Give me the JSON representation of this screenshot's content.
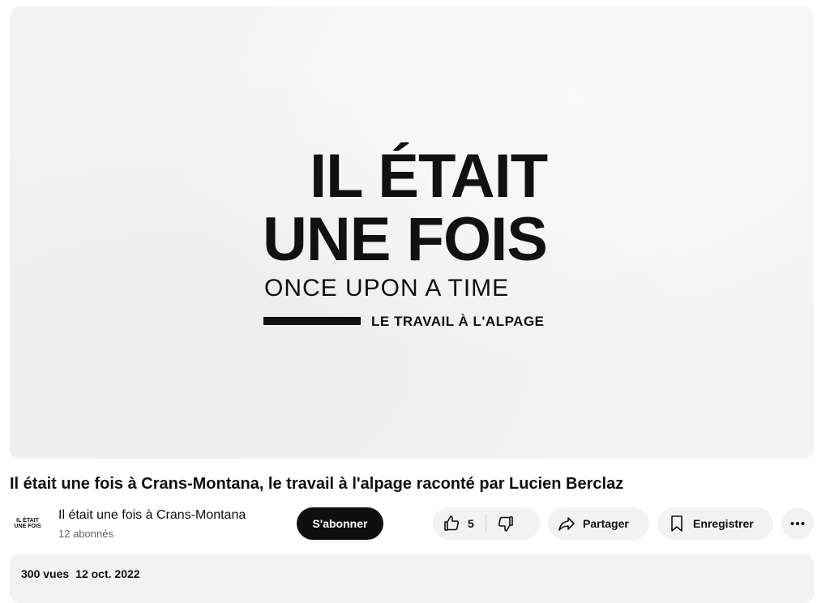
{
  "player": {
    "logo_line1": "IL ÉTAIT",
    "logo_line2": "UNE FOIS",
    "logo_line3": "ONCE UPON A TIME",
    "logo_line4": "LE TRAVAIL À L'ALPAGE"
  },
  "video": {
    "title": "Il était une fois à Crans-Montana, le travail à l'alpage raconté par Lucien Berclaz"
  },
  "channel": {
    "avatar_line1": "IL ÉTAIT",
    "avatar_line2": "UNE FOIS",
    "name": "Il était une fois à Crans-Montana",
    "subscribers": "12 abonnés",
    "subscribe_label": "S'abonner"
  },
  "actions": {
    "like_count": "5",
    "share_label": "Partager",
    "save_label": "Enregistrer"
  },
  "description": {
    "views": "300 vues",
    "date": "12 oct. 2022"
  },
  "icons": {
    "like": "thumbs-up-icon",
    "dislike": "thumbs-down-icon",
    "share": "share-arrow-icon",
    "save": "bookmark-icon",
    "more": "more-horizontal-icon"
  }
}
